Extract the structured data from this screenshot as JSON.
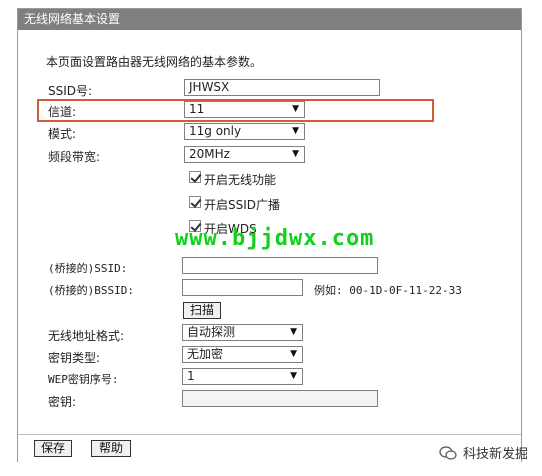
{
  "panel": {
    "title": "无线网络基本设置"
  },
  "description": "本页面设置路由器无线网络的基本参数。",
  "form": {
    "ssid": {
      "label": "SSID号:",
      "value": "JHWSX"
    },
    "channel": {
      "label": "信道:",
      "value": "11"
    },
    "mode": {
      "label": "模式:",
      "value": "11g only"
    },
    "bandwidth": {
      "label": "频段带宽:",
      "value": "20MHz"
    },
    "checkboxes": [
      {
        "label": "开启无线功能",
        "checked": true
      },
      {
        "label": "开启SSID广播",
        "checked": true
      },
      {
        "label": "开启WDS",
        "checked": true
      }
    ],
    "bridge_ssid": {
      "label": "(桥接的)SSID:",
      "value": ""
    },
    "bridge_bssid": {
      "label": "(桥接的)BSSID:",
      "value": "",
      "example": "例如: 00-1D-0F-11-22-33"
    },
    "scan_button": "扫描",
    "addr_format": {
      "label": "无线地址格式:",
      "value": "自动探测"
    },
    "key_type": {
      "label": "密钥类型:",
      "value": "无加密"
    },
    "wep_index": {
      "label": "WEP密钥序号:",
      "value": "1"
    },
    "key": {
      "label": "密钥:",
      "value": ""
    }
  },
  "footer": {
    "save": "保存",
    "help": "帮助"
  },
  "watermark": "www.bjjdwx.com",
  "brand": "科技新发掘",
  "colors": {
    "title_bar": "#7f7f7f",
    "highlight": "#d35a3a",
    "watermark": "#11d11a"
  }
}
